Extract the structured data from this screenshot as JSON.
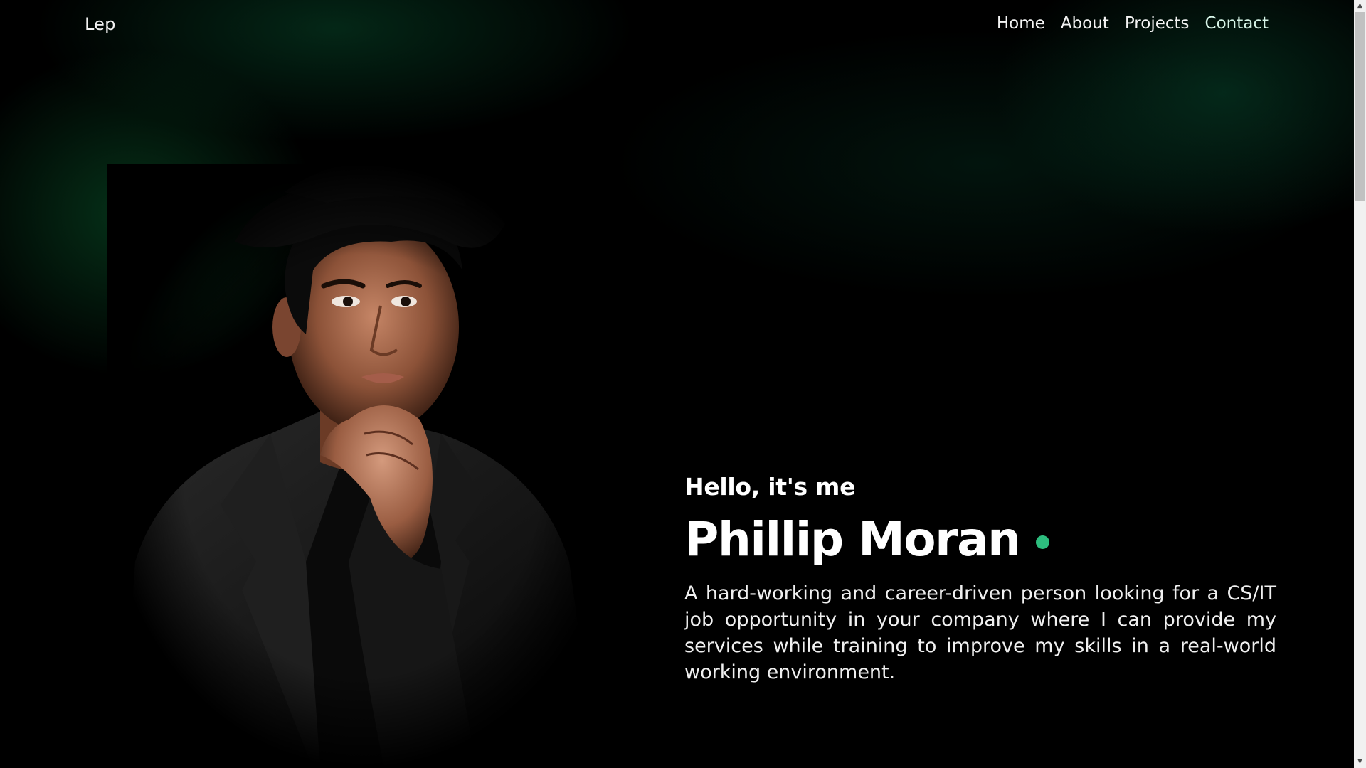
{
  "header": {
    "brand": "Lep",
    "nav": [
      {
        "label": "Home"
      },
      {
        "label": "About"
      },
      {
        "label": "Projects"
      },
      {
        "label": "Contact"
      }
    ]
  },
  "hero": {
    "greeting": "Hello, it's me",
    "name": "Phillip Moran",
    "description": "A hard-working and career-driven person looking for a CS/IT job opportunity in your company where I can provide my services while training to improve my skills in a real-world working environment."
  },
  "colors": {
    "accent": "#2dbd7e",
    "background": "#000000",
    "glow": "#0b5a2d"
  },
  "icons": {
    "status_dot": "green-dot-icon",
    "scroll_up": "chevron-up-icon",
    "scroll_down": "chevron-down-icon"
  }
}
